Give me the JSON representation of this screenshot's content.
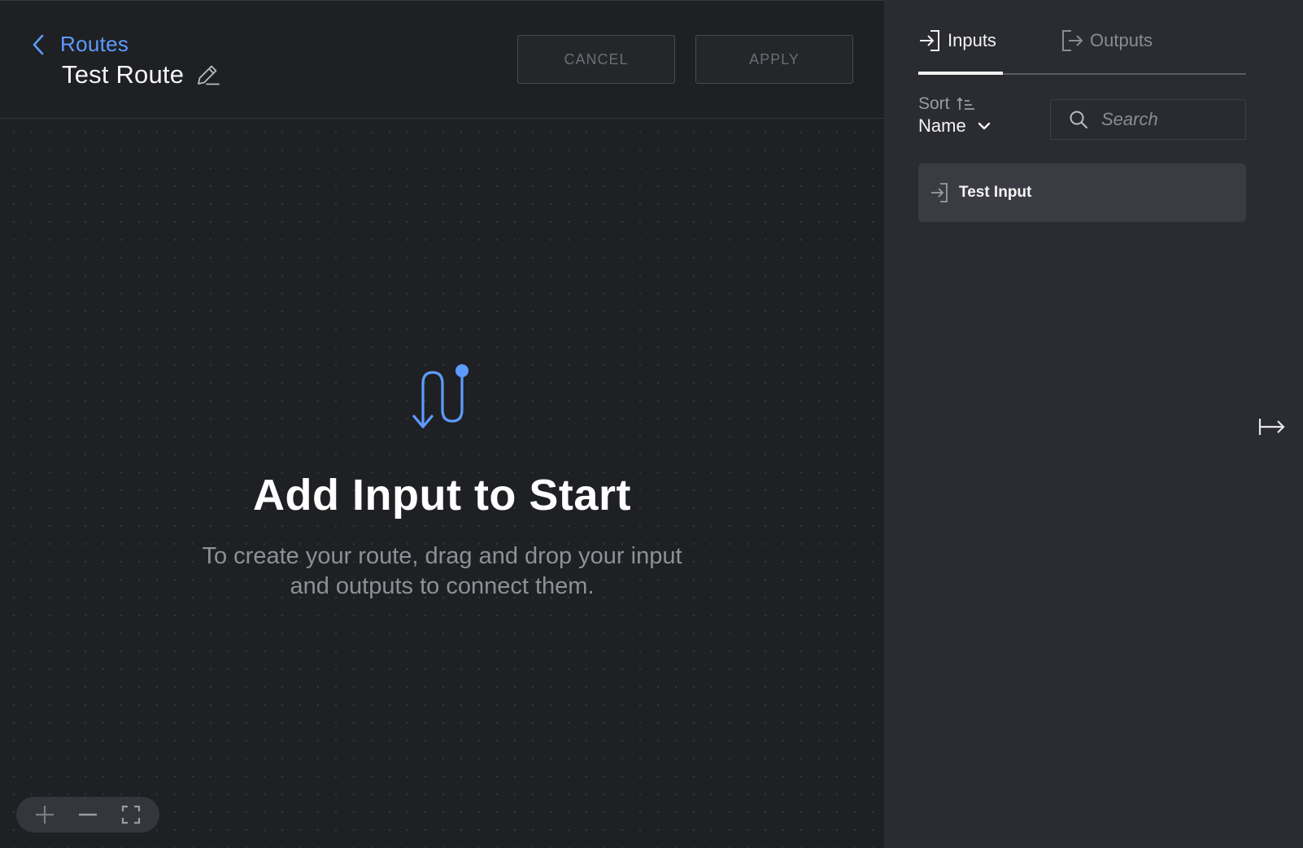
{
  "header": {
    "back_label": "Routes",
    "route_name": "Test Route",
    "cancel_label": "CANCEL",
    "apply_label": "APPLY"
  },
  "empty_state": {
    "title": "Add Input to Start",
    "description": "To create your route, drag and drop your input and outputs to connect them.",
    "icon": "route-icon"
  },
  "zoom_controls": {
    "icons": [
      "zoom-in-icon",
      "zoom-out-icon",
      "fit-view-icon"
    ]
  },
  "panel": {
    "tabs": [
      {
        "label": "Inputs",
        "icon": "input-icon",
        "active": true
      },
      {
        "label": "Outputs",
        "icon": "output-icon",
        "active": false
      }
    ],
    "sort": {
      "label": "Sort",
      "value": "Name"
    },
    "search": {
      "placeholder": "Search"
    },
    "items": [
      {
        "label": "Test Input",
        "icon": "input-icon"
      }
    ]
  },
  "colors": {
    "accent": "#5d9bff",
    "canvas_bg": "#1f2024",
    "panel_bg": "#2b2c31",
    "list_item_bg": "#3b3c43"
  }
}
